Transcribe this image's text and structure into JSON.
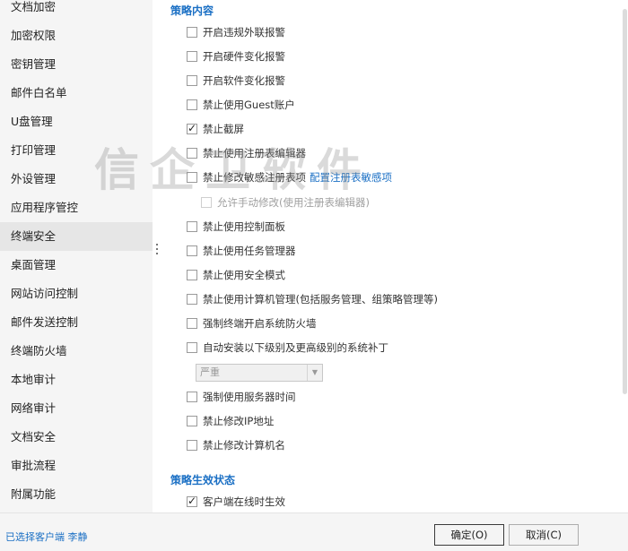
{
  "sidebar": {
    "items": [
      {
        "label": "文档加密"
      },
      {
        "label": "加密权限"
      },
      {
        "label": "密钥管理"
      },
      {
        "label": "邮件白名单"
      },
      {
        "label": "U盘管理"
      },
      {
        "label": "打印管理"
      },
      {
        "label": "外设管理"
      },
      {
        "label": "应用程序管控"
      },
      {
        "label": "终端安全",
        "active": true
      },
      {
        "label": "桌面管理"
      },
      {
        "label": "网站访问控制"
      },
      {
        "label": "邮件发送控制"
      },
      {
        "label": "终端防火墙"
      },
      {
        "label": "本地审计"
      },
      {
        "label": "网络审计"
      },
      {
        "label": "文档安全"
      },
      {
        "label": "审批流程"
      },
      {
        "label": "附属功能"
      }
    ]
  },
  "main": {
    "policy_section_title": "策略内容",
    "options": [
      {
        "label": "开启违规外联报警",
        "checked": false
      },
      {
        "label": "开启硬件变化报警",
        "checked": false
      },
      {
        "label": "开启软件变化报警",
        "checked": false
      },
      {
        "label": "禁止使用Guest账户",
        "checked": false
      },
      {
        "label": "禁止截屏",
        "checked": true
      },
      {
        "label": "禁止使用注册表编辑器",
        "checked": false
      },
      {
        "label": "禁止修改敏感注册表项",
        "checked": false,
        "link": "配置注册表敏感项"
      },
      {
        "label": "允许手动修改(使用注册表编辑器)",
        "checked": false,
        "disabled": true
      },
      {
        "label": "禁止使用控制面板",
        "checked": false
      },
      {
        "label": "禁止使用任务管理器",
        "checked": false
      },
      {
        "label": "禁止使用安全模式",
        "checked": false
      },
      {
        "label": "禁止使用计算机管理(包括服务管理、组策略管理等)",
        "checked": false
      },
      {
        "label": "强制终端开启系统防火墙",
        "checked": false
      },
      {
        "label": "自动安装以下级别及更高级别的系统补丁",
        "checked": false
      },
      {
        "label": "强制使用服务器时间",
        "checked": false
      },
      {
        "label": "禁止修改IP地址",
        "checked": false
      },
      {
        "label": "禁止修改计算机名",
        "checked": false
      }
    ],
    "patch_level_select": {
      "value": "严重"
    },
    "effect_section_title": "策略生效状态",
    "effect_options": [
      {
        "label": "客户端在线时生效",
        "checked": true
      }
    ]
  },
  "watermark": "信企卫软件",
  "footer": {
    "status": "已选择客户端 李静",
    "ok_label": "确定(O)",
    "cancel_label": "取消(C)"
  },
  "colors": {
    "accent": "#1a6fc4",
    "sidebar_bg": "#f5f5f5",
    "sidebar_active": "#e6e6e6"
  }
}
